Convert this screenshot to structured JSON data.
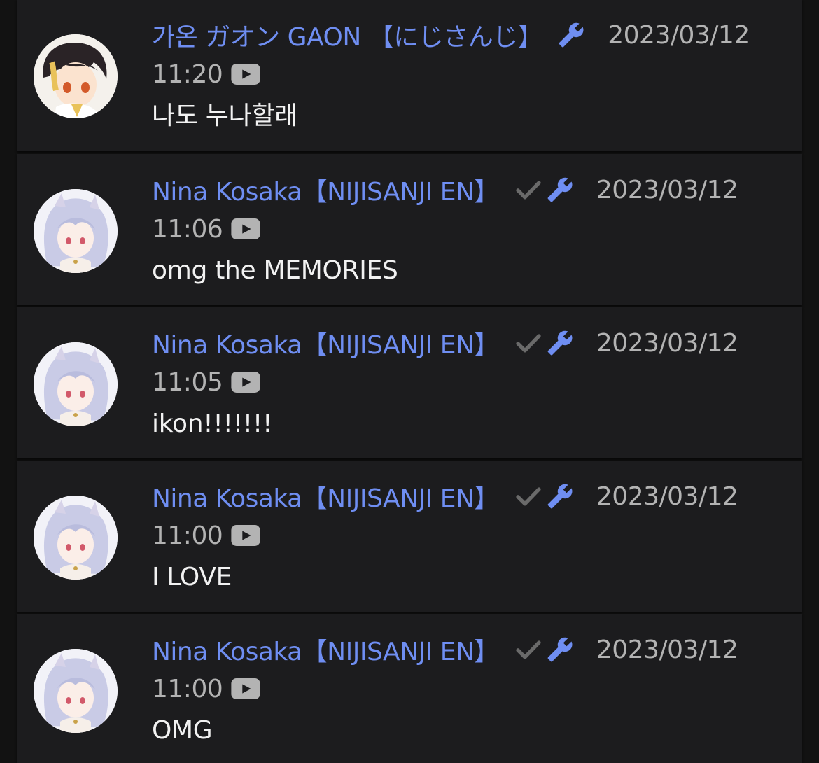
{
  "colors": {
    "background": "#121212",
    "card": "#1c1c1e",
    "author": "#6f8ef2",
    "timestamp": "#b3b3b3",
    "text": "#f2f2f2",
    "verified": "#6a6a6a"
  },
  "icons": {
    "verified": "check-icon",
    "moderator": "wrench-icon",
    "source": "youtube-icon"
  },
  "comments": [
    {
      "author": "가온 ガオン GAON 【にじさんじ】",
      "verified": false,
      "moderator": true,
      "date": "2023/03/12",
      "time": "11:20",
      "text": "나도 누나할래"
    },
    {
      "author": "Nina Kosaka【NIJISANJI EN】",
      "verified": true,
      "moderator": true,
      "date": "2023/03/12",
      "time": "11:06",
      "text": "omg the MEMORIES"
    },
    {
      "author": "Nina Kosaka【NIJISANJI EN】",
      "verified": true,
      "moderator": true,
      "date": "2023/03/12",
      "time": "11:05",
      "text": "ikon!!!!!!!"
    },
    {
      "author": "Nina Kosaka【NIJISANJI EN】",
      "verified": true,
      "moderator": true,
      "date": "2023/03/12",
      "time": "11:00",
      "text": "I LOVE"
    },
    {
      "author": "Nina Kosaka【NIJISANJI EN】",
      "verified": true,
      "moderator": true,
      "date": "2023/03/12",
      "time": "11:00",
      "text": "OMG"
    }
  ]
}
